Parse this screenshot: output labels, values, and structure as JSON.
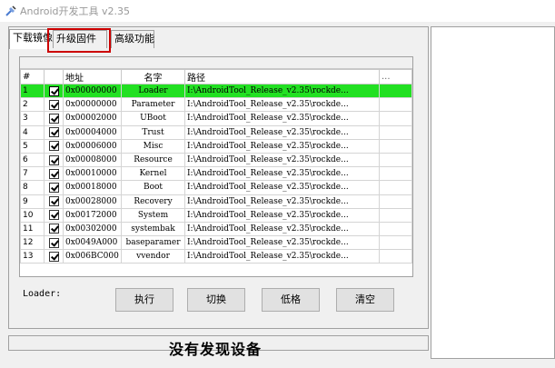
{
  "window": {
    "title": "Android开发工具 v2.35"
  },
  "tabs": [
    {
      "label": "下载镜像"
    },
    {
      "label": "升级固件"
    },
    {
      "label": "高级功能"
    }
  ],
  "grid": {
    "headers": {
      "idx": "#",
      "address": "地址",
      "name": "名字",
      "path": "路径",
      "extra": "..."
    },
    "rows": [
      {
        "idx": "1",
        "address": "0x00000000",
        "name": "Loader",
        "path": "I:\\AndroidTool_Release_v2.35\\rockde...",
        "selected": true
      },
      {
        "idx": "2",
        "address": "0x00000000",
        "name": "Parameter",
        "path": "I:\\AndroidTool_Release_v2.35\\rockde..."
      },
      {
        "idx": "3",
        "address": "0x00002000",
        "name": "UBoot",
        "path": "I:\\AndroidTool_Release_v2.35\\rockde..."
      },
      {
        "idx": "4",
        "address": "0x00004000",
        "name": "Trust",
        "path": "I:\\AndroidTool_Release_v2.35\\rockde..."
      },
      {
        "idx": "5",
        "address": "0x00006000",
        "name": "Misc",
        "path": "I:\\AndroidTool_Release_v2.35\\rockde..."
      },
      {
        "idx": "6",
        "address": "0x00008000",
        "name": "Resource",
        "path": "I:\\AndroidTool_Release_v2.35\\rockde..."
      },
      {
        "idx": "7",
        "address": "0x00010000",
        "name": "Kernel",
        "path": "I:\\AndroidTool_Release_v2.35\\rockde..."
      },
      {
        "idx": "8",
        "address": "0x00018000",
        "name": "Boot",
        "path": "I:\\AndroidTool_Release_v2.35\\rockde..."
      },
      {
        "idx": "9",
        "address": "0x00028000",
        "name": "Recovery",
        "path": "I:\\AndroidTool_Release_v2.35\\rockde..."
      },
      {
        "idx": "10",
        "address": "0x00172000",
        "name": "System",
        "path": "I:\\AndroidTool_Release_v2.35\\rockde..."
      },
      {
        "idx": "11",
        "address": "0x00302000",
        "name": "systembak",
        "path": "I:\\AndroidTool_Release_v2.35\\rockde..."
      },
      {
        "idx": "12",
        "address": "0x0049A000",
        "name": "baseparamer",
        "path": "I:\\AndroidTool_Release_v2.35\\rockde..."
      },
      {
        "idx": "13",
        "address": "0x006BC000",
        "name": "vvendor",
        "path": "I:\\AndroidTool_Release_v2.35\\rockde..."
      }
    ]
  },
  "loader_label": "Loader:",
  "buttons": {
    "execute": "执行",
    "switch": "切换",
    "lowformat": "低格",
    "clear": "清空"
  },
  "status": {
    "message": "没有发现设备"
  },
  "colors": {
    "selected_row": "#22e022",
    "highlight_box": "#cc0000"
  }
}
